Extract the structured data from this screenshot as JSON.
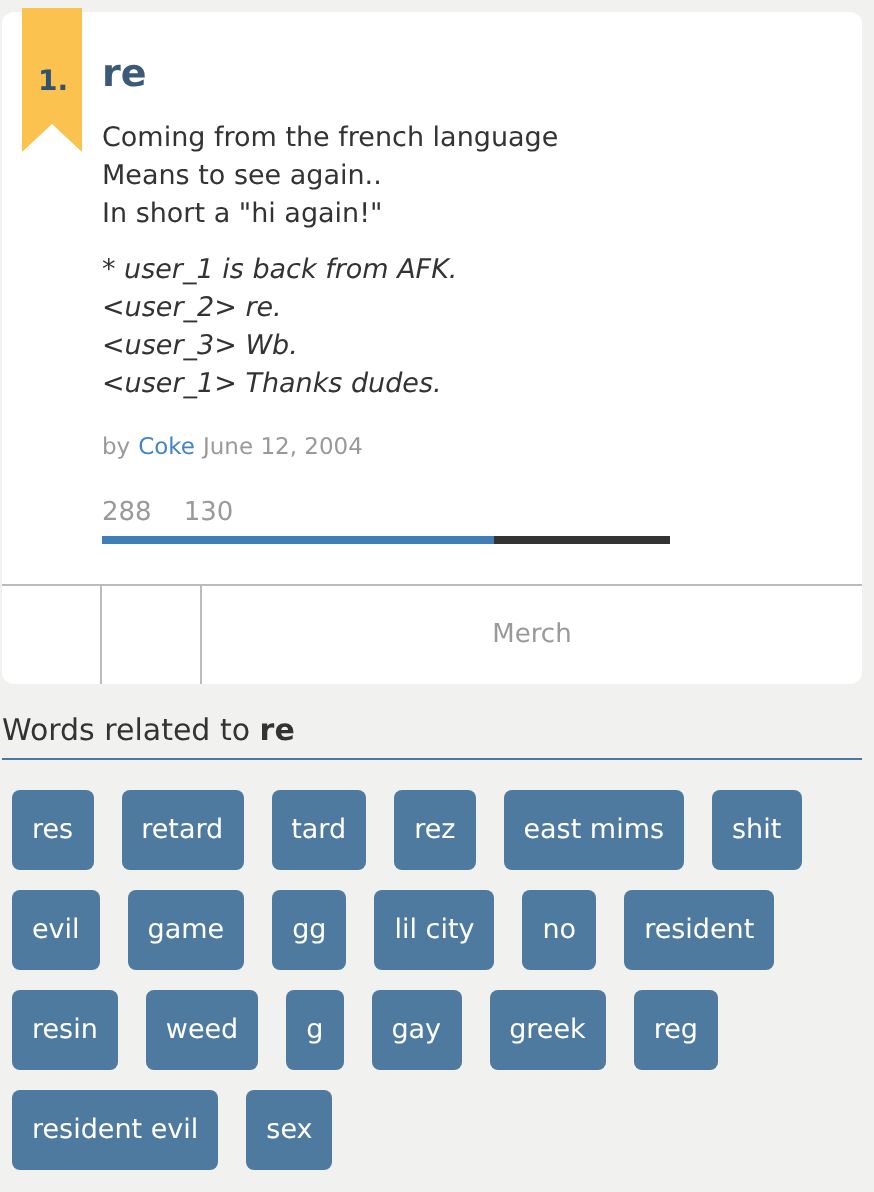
{
  "definition": {
    "rank": "1.",
    "word": "re",
    "meaning": [
      "Coming from the french language",
      "Means to see again..",
      "In short a \"hi again!\""
    ],
    "example": [
      "* user_1 is back from AFK.",
      "<user_2> re.",
      "<user_3> Wb.",
      "<user_1> Thanks dudes."
    ],
    "by": "by",
    "author": "Coke",
    "date": "June 12, 2004",
    "upvotes": "288",
    "downvotes": "130",
    "level": 0.69,
    "footer": {
      "merch": "Merch"
    }
  },
  "related": {
    "heading": "Words related to **re**",
    "tags": [
      "res",
      "retard",
      "tard",
      "rez",
      "east mims",
      "shit",
      "evil",
      "game",
      "gg",
      "lil city",
      "no",
      "resident",
      "resin",
      "weed",
      "g",
      "gay",
      "greek",
      "reg",
      "resident evil",
      "sex"
    ]
  }
}
